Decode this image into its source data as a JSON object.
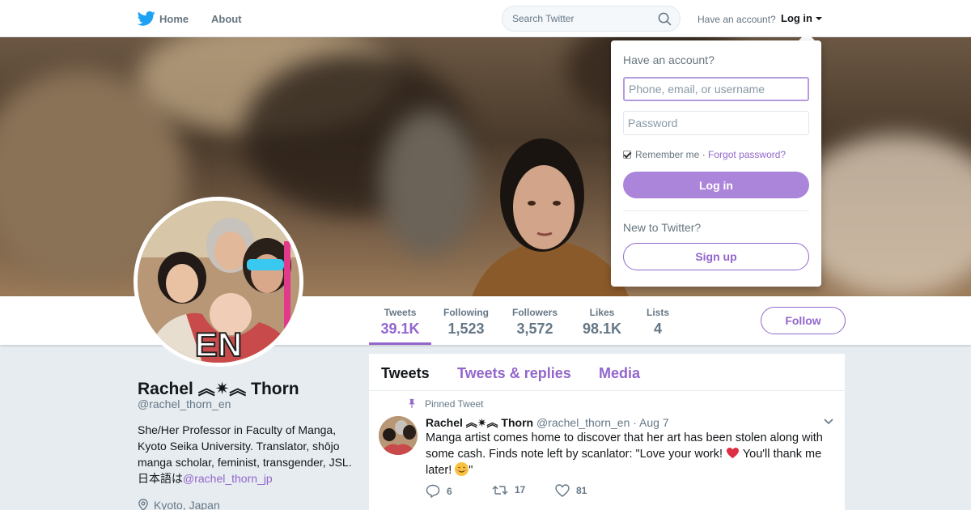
{
  "colors": {
    "accent": "#9266cc",
    "twitter_blue": "#1da1f2",
    "link": "#9266cc",
    "login_button": "#ab85d9"
  },
  "nav": {
    "home": "Home",
    "about": "About",
    "search_placeholder": "Search Twitter",
    "have_account": "Have an account?",
    "login": "Log in"
  },
  "login_dropdown": {
    "title": "Have an account?",
    "username_placeholder": "Phone, email, or username",
    "password_placeholder": "Password",
    "remember_me": "Remember me",
    "separator": "·",
    "forgot_password": "Forgot password?",
    "login_button": "Log in",
    "new_to_twitter": "New to Twitter?",
    "signup_button": "Sign up"
  },
  "stats": [
    {
      "label": "Tweets",
      "value": "39.1K"
    },
    {
      "label": "Following",
      "value": "1,523"
    },
    {
      "label": "Followers",
      "value": "3,572"
    },
    {
      "label": "Likes",
      "value": "98.1K"
    },
    {
      "label": "Lists",
      "value": "4"
    }
  ],
  "follow_button": "Follow",
  "profile": {
    "name": "Rachel ︽✷︽ Thorn",
    "handle": "@rachel_thorn_en",
    "bio_text": "She/Her Professor in Faculty of Manga, Kyoto Seika University. Translator, shōjo manga scholar, feminist, transgender, JSL. 日本語は",
    "bio_link": "@rachel_thorn_jp",
    "location": "Kyoto, Japan",
    "avatar_badge": "EN"
  },
  "timeline": {
    "tabs": [
      "Tweets",
      "Tweets & replies",
      "Media"
    ]
  },
  "pinned_tweet": {
    "pinned_label": "Pinned Tweet",
    "author_name": "Rachel ︽✷︽ Thorn",
    "author_handle": "@rachel_thorn_en",
    "date": "· Aug 7",
    "text_part1": "Manga artist comes home to discover that her art has been stolen along with some cash. Finds note left by scanlator: \"Love your work! ",
    "text_part2": " You'll thank me later! ",
    "text_part3": "\"",
    "replies": "6",
    "retweets": "17",
    "likes": "81"
  }
}
